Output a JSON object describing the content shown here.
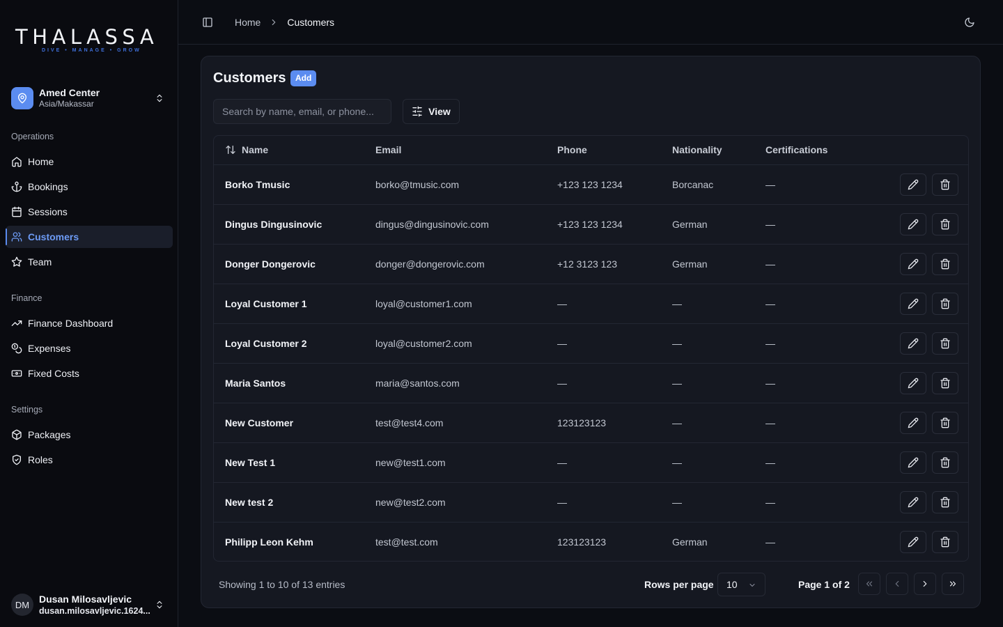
{
  "brand": {
    "name": "THALASSA",
    "tagline": "DIVE • MANAGE • GROW",
    "accent": "#5b8cf0"
  },
  "center": {
    "name": "Amed Center",
    "timezone": "Asia/Makassar"
  },
  "nav": {
    "operations_heading": "Operations",
    "operations": [
      {
        "label": "Home",
        "icon": "home-icon"
      },
      {
        "label": "Bookings",
        "icon": "anchor-icon"
      },
      {
        "label": "Sessions",
        "icon": "calendar-icon"
      },
      {
        "label": "Customers",
        "icon": "users-icon",
        "active": true
      },
      {
        "label": "Team",
        "icon": "star-icon"
      }
    ],
    "finance_heading": "Finance",
    "finance": [
      {
        "label": "Finance Dashboard",
        "icon": "trending-up-icon"
      },
      {
        "label": "Expenses",
        "icon": "coins-icon"
      },
      {
        "label": "Fixed Costs",
        "icon": "banknote-icon"
      }
    ],
    "settings_heading": "Settings",
    "settings": [
      {
        "label": "Packages",
        "icon": "package-icon"
      },
      {
        "label": "Roles",
        "icon": "shield-icon"
      }
    ]
  },
  "user": {
    "initials": "DM",
    "name": "Dusan Milosavljevic",
    "email": "dusan.milosavljevic.1624..."
  },
  "breadcrumb": {
    "home": "Home",
    "current": "Customers"
  },
  "page": {
    "title": "Customers",
    "add_label": "Add",
    "search_placeholder": "Search by name, email, or phone...",
    "view_label": "View"
  },
  "table": {
    "columns": [
      "Name",
      "Email",
      "Phone",
      "Nationality",
      "Certifications"
    ],
    "rows": [
      {
        "name": "Borko Tmusic",
        "email": "borko@tmusic.com",
        "phone": "+123 123 1234",
        "nationality": "Borcanac",
        "certifications": "—"
      },
      {
        "name": "Dingus Dingusinovic",
        "email": "dingus@dingusinovic.com",
        "phone": "+123 123 1234",
        "nationality": "German",
        "certifications": "—"
      },
      {
        "name": "Donger Dongerovic",
        "email": "donger@dongerovic.com",
        "phone": "+12 3123 123",
        "nationality": "German",
        "certifications": "—"
      },
      {
        "name": "Loyal Customer 1",
        "email": "loyal@customer1.com",
        "phone": "—",
        "nationality": "—",
        "certifications": "—"
      },
      {
        "name": "Loyal Customer 2",
        "email": "loyal@customer2.com",
        "phone": "—",
        "nationality": "—",
        "certifications": "—"
      },
      {
        "name": "Maria Santos",
        "email": "maria@santos.com",
        "phone": "—",
        "nationality": "—",
        "certifications": "—"
      },
      {
        "name": "New Customer",
        "email": "test@test4.com",
        "phone": "123123123",
        "nationality": "—",
        "certifications": "—"
      },
      {
        "name": "New Test 1",
        "email": "new@test1.com",
        "phone": "—",
        "nationality": "—",
        "certifications": "—"
      },
      {
        "name": "New test 2",
        "email": "new@test2.com",
        "phone": "—",
        "nationality": "—",
        "certifications": "—"
      },
      {
        "name": "Philipp Leon Kehm",
        "email": "test@test.com",
        "phone": "123123123",
        "nationality": "German",
        "certifications": "—"
      }
    ]
  },
  "pagination": {
    "summary": "Showing 1 to 10 of 13 entries",
    "rows_per_page_label": "Rows per page",
    "rows_per_page": "10",
    "page_label": "Page 1 of 2"
  }
}
